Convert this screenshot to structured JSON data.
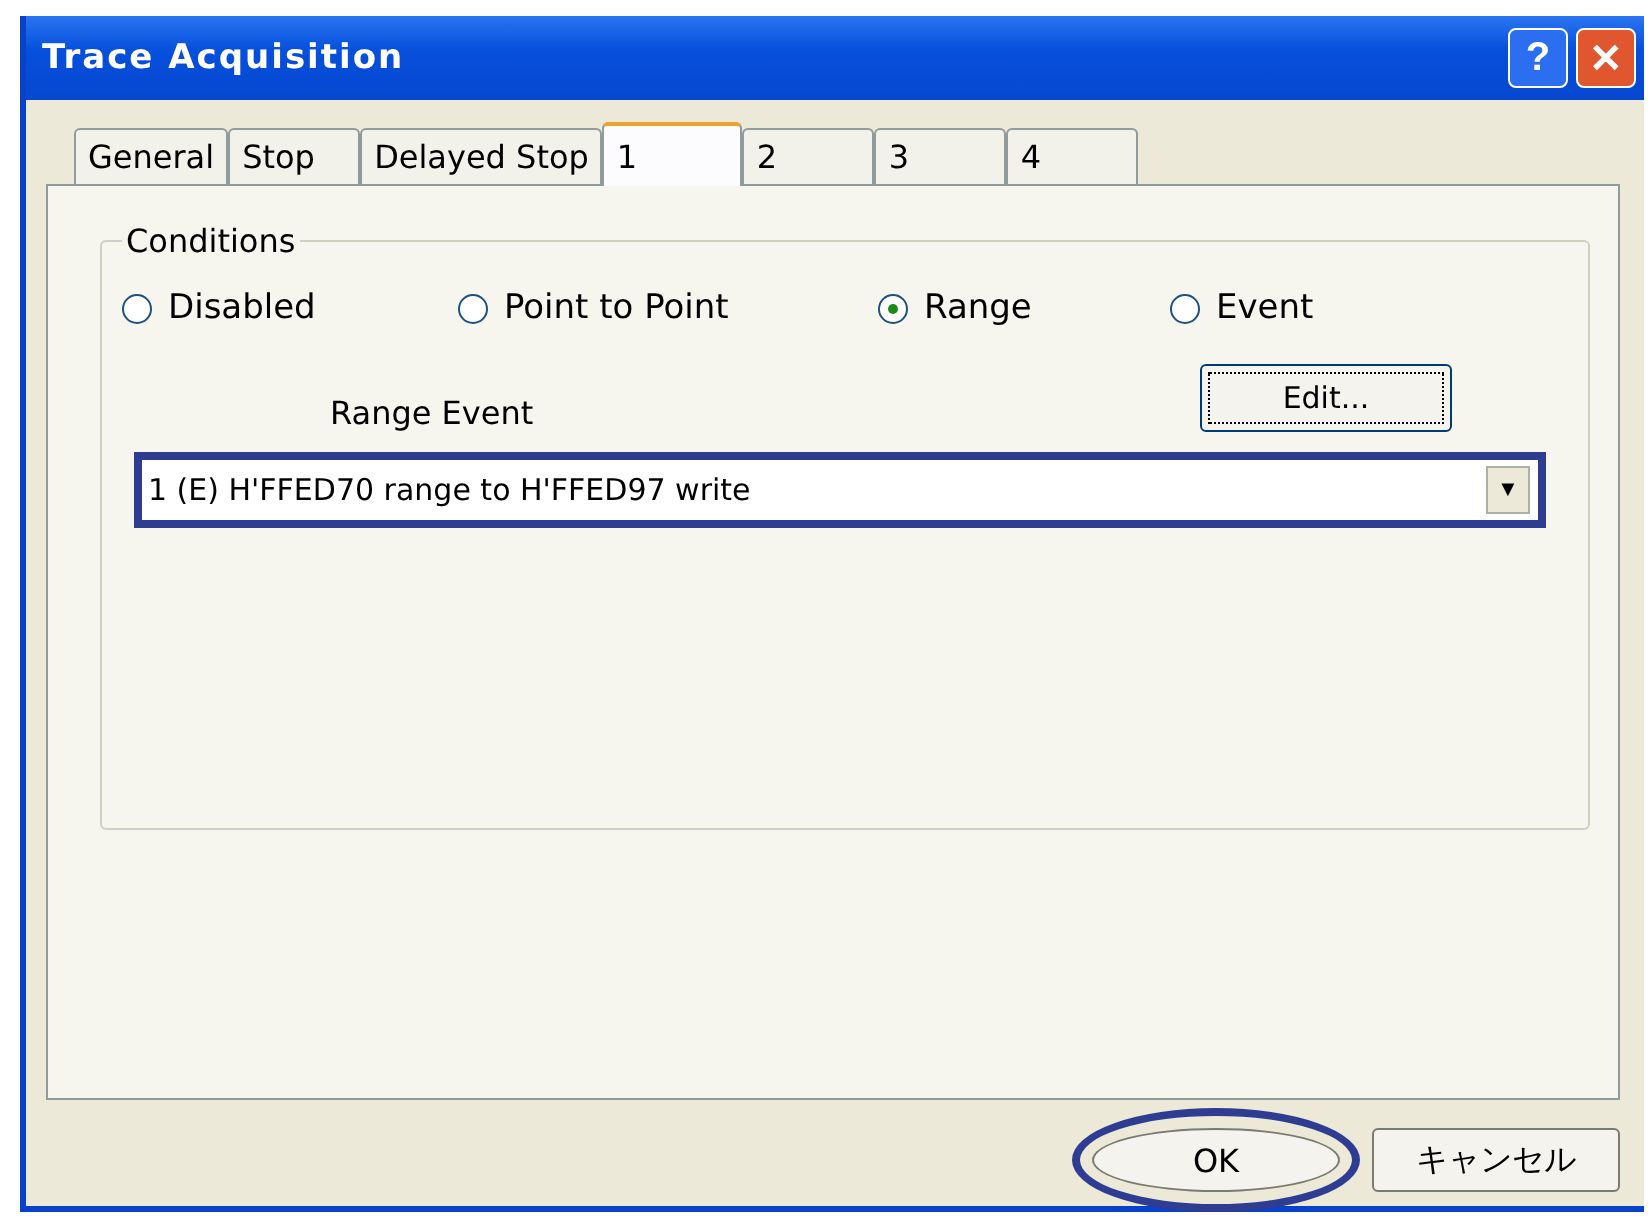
{
  "window": {
    "title": "Trace Acquisition",
    "title_buttons": [
      "?",
      "✕"
    ]
  },
  "tabs": [
    {
      "label": "General",
      "selected": false
    },
    {
      "label": "Stop",
      "selected": false
    },
    {
      "label": "Delayed Stop",
      "selected": false
    },
    {
      "label": "1",
      "selected": true
    },
    {
      "label": "2",
      "selected": false
    },
    {
      "label": "3",
      "selected": false
    },
    {
      "label": "4",
      "selected": false
    }
  ],
  "conditions": {
    "title": "Conditions",
    "options": [
      {
        "label": "Disabled",
        "selected": false
      },
      {
        "label": "Point to Point",
        "selected": false
      },
      {
        "label": "Range",
        "selected": true
      },
      {
        "label": "Event",
        "selected": false
      }
    ],
    "range_event_label": "Range Event",
    "edit_button": "Edit...",
    "dropdown": {
      "value": "1 (E) H'FFED70 range to H'FFED97 write",
      "arrow": "▼",
      "highlighted": true
    }
  },
  "buttons": [
    {
      "label": "OK",
      "highlighted": true
    },
    {
      "label": "キャンセル",
      "highlighted": false
    }
  ]
}
